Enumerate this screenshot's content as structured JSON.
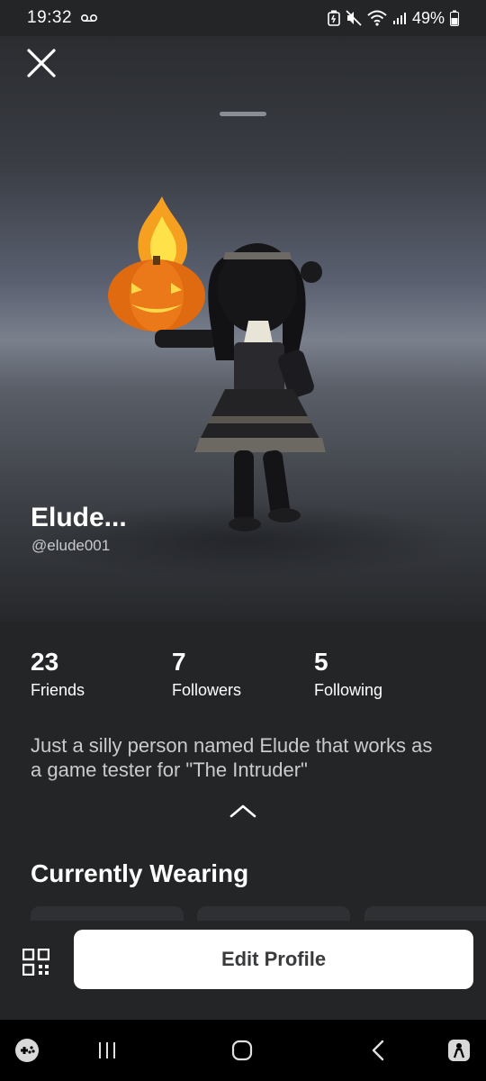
{
  "status_bar": {
    "time": "19:32",
    "battery": "49%",
    "icons": [
      "voicemail-icon",
      "battery-saver-icon",
      "mute-icon",
      "wifi-icon",
      "signal-icon",
      "battery-icon"
    ]
  },
  "profile": {
    "display_name": "Elude...",
    "username": "@elude001",
    "bio": "Just a silly person named Elude that works as a game tester for \"The Intruder\""
  },
  "stats": [
    {
      "count": "23",
      "label": "Friends"
    },
    {
      "count": "7",
      "label": "Followers"
    },
    {
      "count": "5",
      "label": "Following"
    }
  ],
  "sections": {
    "currently_wearing": "Currently Wearing"
  },
  "actions": {
    "edit_profile": "Edit Profile",
    "qr_icon": "qr-code-icon",
    "close_icon": "close-icon",
    "expand_icon": "chevron-up-icon"
  },
  "nav_bar": {
    "icons": [
      "game-launcher-icon",
      "recent-apps-icon",
      "home-icon",
      "back-icon",
      "accessibility-icon"
    ]
  },
  "colors": {
    "background": "#232527",
    "button_bg": "#ffffff",
    "button_text": "#393b3d",
    "secondary_text": "#c9cbce"
  }
}
